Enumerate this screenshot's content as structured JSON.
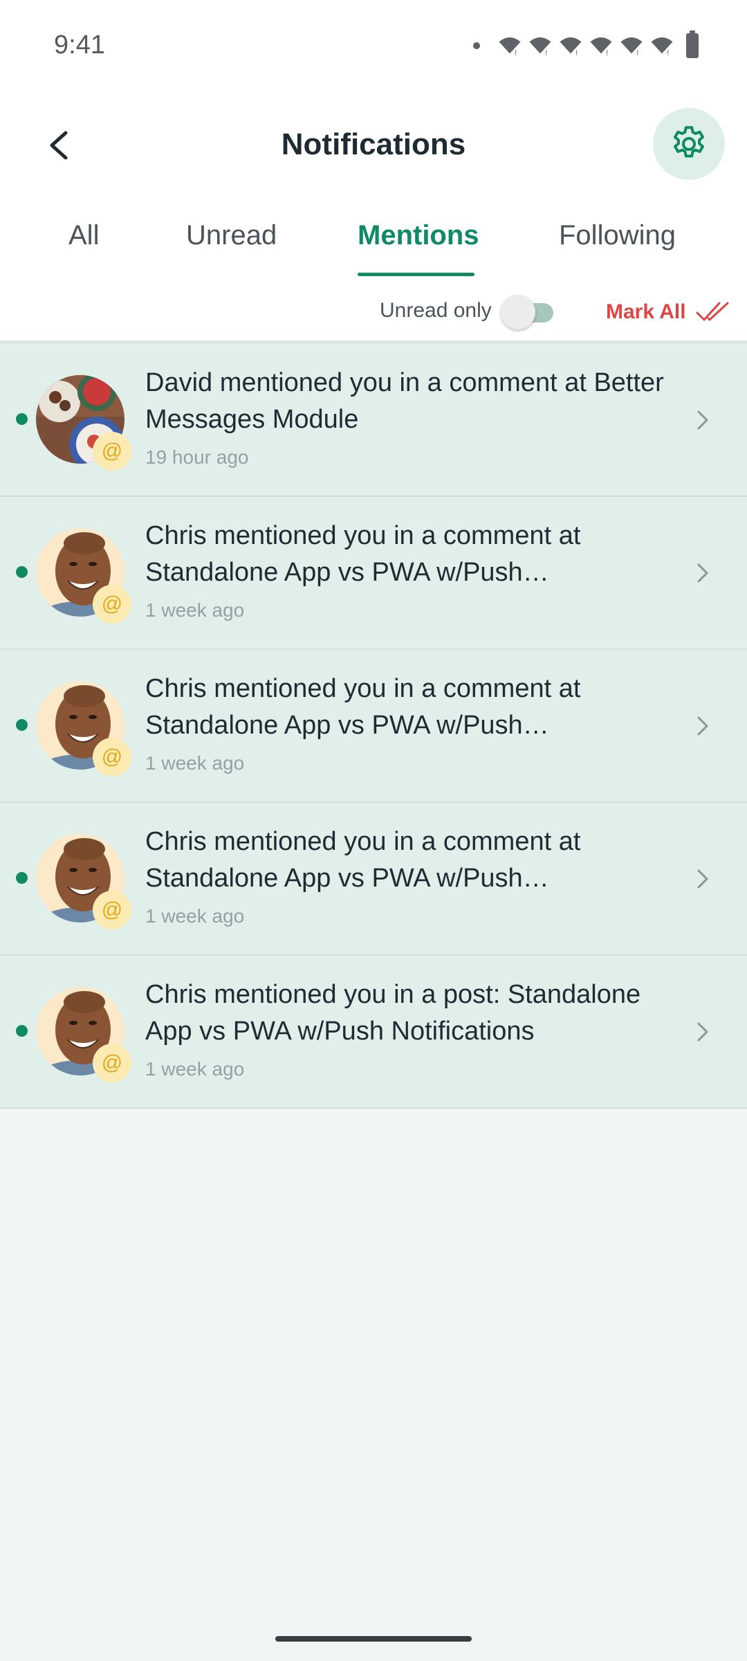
{
  "status_bar": {
    "time": "9:41",
    "icons": [
      "dot",
      "wifi-icon",
      "wifi-icon",
      "wifi-icon",
      "wifi-icon",
      "wifi-icon",
      "wifi-icon",
      "battery-icon"
    ]
  },
  "header": {
    "title": "Notifications",
    "back_icon": "chevron-left-icon",
    "settings_icon": "gear-icon"
  },
  "tabs": [
    {
      "label": "All",
      "active": false
    },
    {
      "label": "Unread",
      "active": false
    },
    {
      "label": "Mentions",
      "active": true
    },
    {
      "label": "Following",
      "active": false
    }
  ],
  "filters": {
    "unread_only_label": "Unread only",
    "unread_only_enabled": false,
    "mark_all_label": "Mark All",
    "mark_all_icon": "double-check-icon"
  },
  "colors": {
    "accent": "#108a63",
    "danger": "#e04545",
    "unread_bg": "#e1efea",
    "badge_bg": "#fbeab2"
  },
  "notifications": [
    {
      "author": "David",
      "avatar": "food-bowls-photo",
      "message": "David mentioned you in a comment at Better Messages Module",
      "time": "19 hour ago",
      "unread": true,
      "badge": "@"
    },
    {
      "author": "Chris",
      "avatar": "smiling-man-photo",
      "message": "Chris mentioned you in a comment at Standalone App vs PWA w/Push Notifications",
      "time": "1 week ago",
      "unread": true,
      "badge": "@"
    },
    {
      "author": "Chris",
      "avatar": "smiling-man-photo",
      "message": "Chris mentioned you in a comment at Standalone App vs PWA w/Push Notifications",
      "time": "1 week ago",
      "unread": true,
      "badge": "@"
    },
    {
      "author": "Chris",
      "avatar": "smiling-man-photo",
      "message": "Chris mentioned you in a comment at Standalone App vs PWA w/Push Notifications",
      "time": "1 week ago",
      "unread": true,
      "badge": "@"
    },
    {
      "author": "Chris",
      "avatar": "smiling-man-photo",
      "message": "Chris mentioned you in a post: Standalone App vs PWA w/Push Notifications",
      "time": "1 week ago",
      "unread": true,
      "badge": "@"
    }
  ]
}
